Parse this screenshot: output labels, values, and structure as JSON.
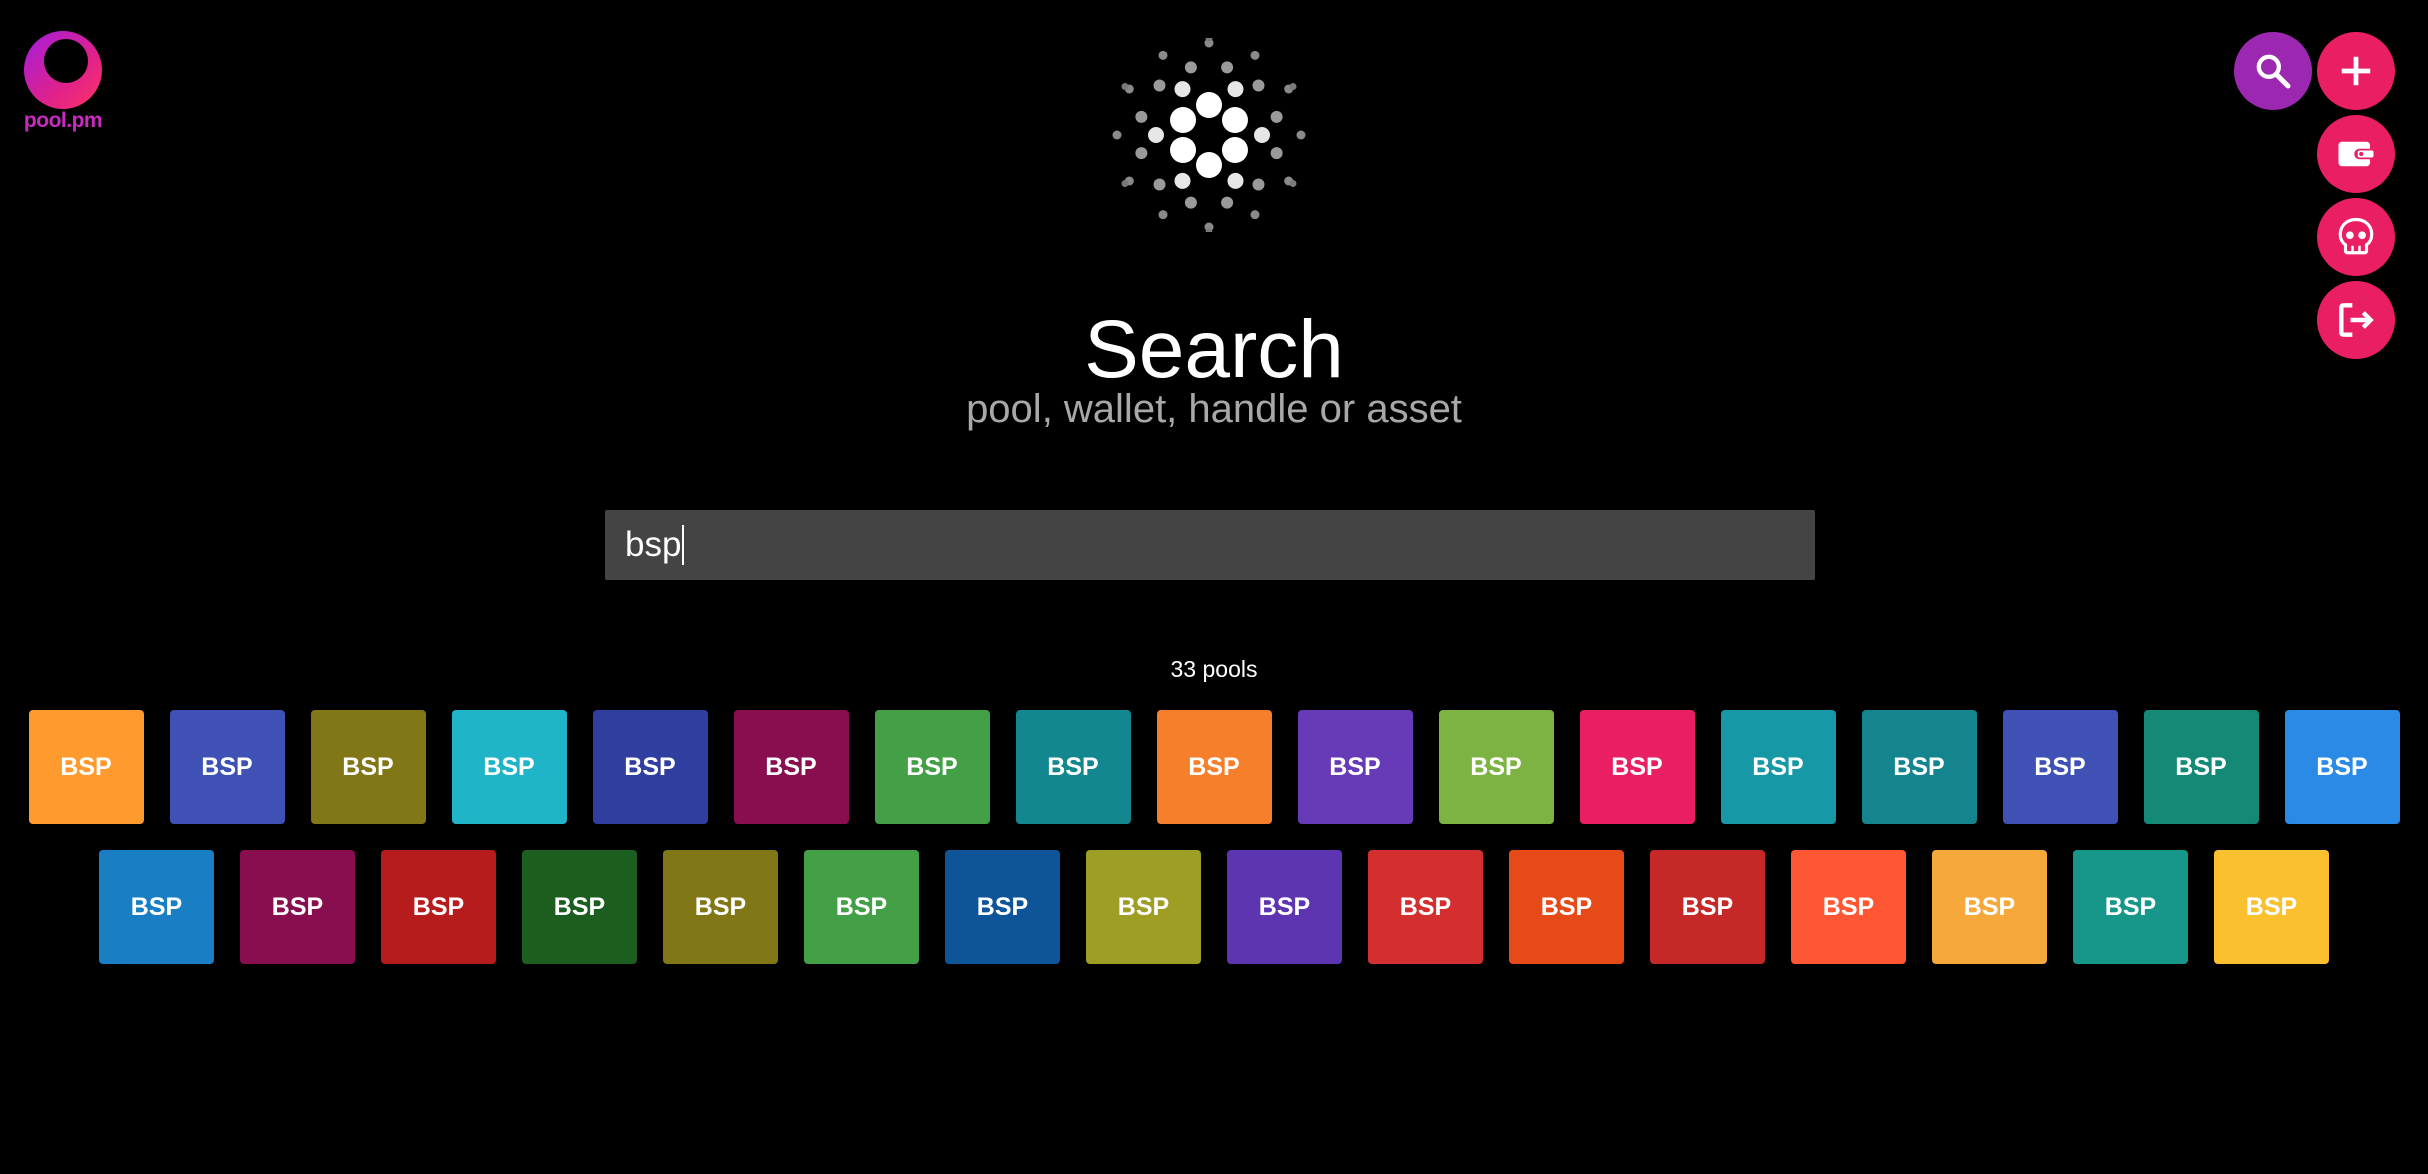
{
  "logo": {
    "text": "pool.pm"
  },
  "header": {
    "title": "Search",
    "subtitle": "pool, wallet, handle or asset"
  },
  "search": {
    "value": "bsp",
    "placeholder": ""
  },
  "results": {
    "count_label": "33 pools",
    "row1": [
      {
        "ticker": "BSP",
        "color": "#ff9a2e"
      },
      {
        "ticker": "BSP",
        "color": "#3f51b5"
      },
      {
        "ticker": "BSP",
        "color": "#827717"
      },
      {
        "ticker": "BSP",
        "color": "#1fb4c8"
      },
      {
        "ticker": "BSP",
        "color": "#303f9f"
      },
      {
        "ticker": "BSP",
        "color": "#880e4f"
      },
      {
        "ticker": "BSP",
        "color": "#43a047"
      },
      {
        "ticker": "BSP",
        "color": "#138790"
      },
      {
        "ticker": "BSP",
        "color": "#f57f2a"
      },
      {
        "ticker": "BSP",
        "color": "#673ab7"
      },
      {
        "ticker": "BSP",
        "color": "#7cb342"
      },
      {
        "ticker": "BSP",
        "color": "#e91e63"
      },
      {
        "ticker": "BSP",
        "color": "#1698a6"
      },
      {
        "ticker": "BSP",
        "color": "#14858e"
      },
      {
        "ticker": "BSP",
        "color": "#3f51b5"
      },
      {
        "ticker": "BSP",
        "color": "#148a76"
      },
      {
        "ticker": "BSP",
        "color": "#2a8ae6"
      }
    ],
    "row2": [
      {
        "ticker": "BSP",
        "color": "#1a7ec4"
      },
      {
        "ticker": "BSP",
        "color": "#880e4f"
      },
      {
        "ticker": "BSP",
        "color": "#b71c1c"
      },
      {
        "ticker": "BSP",
        "color": "#1b5e20"
      },
      {
        "ticker": "BSP",
        "color": "#827717"
      },
      {
        "ticker": "BSP",
        "color": "#43a047"
      },
      {
        "ticker": "BSP",
        "color": "#0d5499"
      },
      {
        "ticker": "BSP",
        "color": "#9e9d24"
      },
      {
        "ticker": "BSP",
        "color": "#5e35b1"
      },
      {
        "ticker": "BSP",
        "color": "#d32f2f"
      },
      {
        "ticker": "BSP",
        "color": "#e64a19"
      },
      {
        "ticker": "BSP",
        "color": "#c62828"
      },
      {
        "ticker": "BSP",
        "color": "#ff5733"
      },
      {
        "ticker": "BSP",
        "color": "#f7a83a"
      },
      {
        "ticker": "BSP",
        "color": "#16978a"
      },
      {
        "ticker": "BSP",
        "color": "#fbc02d"
      }
    ]
  },
  "actions": [
    {
      "icon": "search-icon",
      "color": "#9c27b0"
    },
    {
      "icon": "plus-icon",
      "color": "#e91e63"
    },
    {
      "icon": "wallet-icon",
      "color": "#e91e63"
    },
    {
      "icon": "skull-icon",
      "color": "#e91e63"
    },
    {
      "icon": "logout-icon",
      "color": "#e91e63"
    }
  ]
}
